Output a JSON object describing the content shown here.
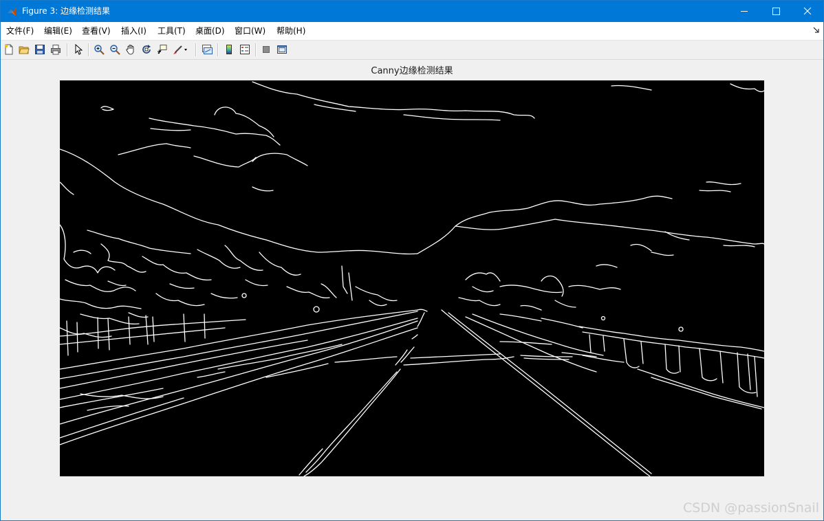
{
  "window": {
    "title": "Figure 3: 边缘检测结果"
  },
  "menu": [
    "文件(F)",
    "编辑(E)",
    "查看(V)",
    "插入(I)",
    "工具(T)",
    "桌面(D)",
    "窗口(W)",
    "帮助(H)"
  ],
  "toolbar": {
    "buttons": [
      "new-figure",
      "open-file",
      "save",
      "print",
      "select-pointer",
      "zoom-in",
      "zoom-out",
      "pan",
      "rotate-3d",
      "data-cursor",
      "brush",
      "link-plot",
      "insert-colorbar",
      "insert-legend",
      "hide-plot-tools",
      "show-plot-tools"
    ]
  },
  "figure": {
    "title": "Canny边缘检测结果"
  },
  "watermark": "CSDN @passionSnail",
  "colors": {
    "titlebar": "#0078d7",
    "axes_background": "#000000",
    "edges": "#ffffff"
  }
}
